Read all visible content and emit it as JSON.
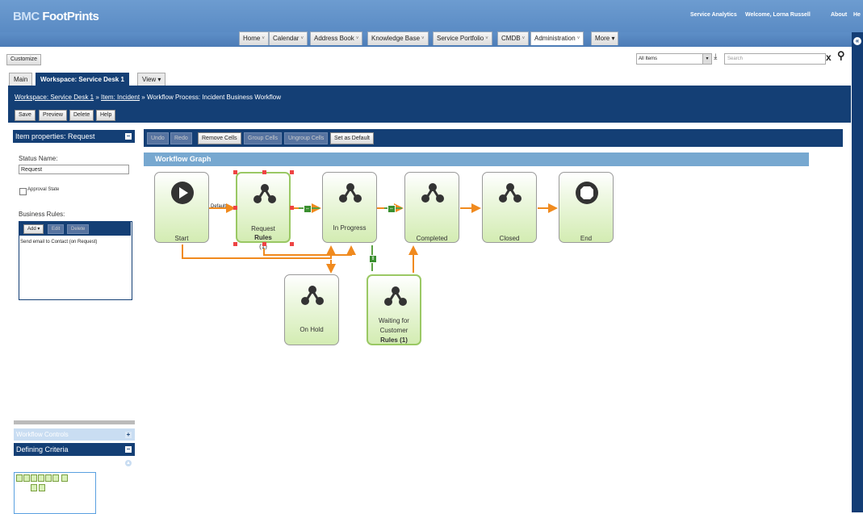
{
  "header": {
    "logo_left": "BMC",
    "logo_right": "FootPrints",
    "links": [
      "Service Analytics",
      "Welcome, Lorna Russell",
      "About",
      "He"
    ]
  },
  "nav_tabs": [
    "Home",
    "Calendar",
    "Address Book",
    "Knowledge Base",
    "Service Portfolio",
    "CMDB",
    "Administration",
    "More ▾"
  ],
  "toolbar_row": {
    "customize": "Customize",
    "filter_value": "All Items",
    "search_placeholder": "Search",
    "clear_label": "x"
  },
  "workspace_tabs": [
    "Main",
    "Workspace: Service Desk 1",
    "View ▾"
  ],
  "breadcrumb": {
    "items": [
      "Workspace: Service Desk 1",
      "Item: Incident",
      "Workflow Process: Incident Business Workflow"
    ],
    "sep": "»"
  },
  "action_buttons": [
    "Save",
    "Preview",
    "Delete",
    "Help"
  ],
  "left_panel": {
    "title": "Item properties: Request",
    "status_name_label": "Status Name:",
    "status_name_value": "Request",
    "approval_state_label": "Approval State",
    "business_rules_label": "Business Rules:",
    "rules_buttons": [
      "Add ▾",
      "Edit",
      "Delete"
    ],
    "rules": [
      "Send email to Contact (on Request)"
    ],
    "workflow_controls": "Workflow Controls",
    "defining_criteria": "Defining Criteria"
  },
  "graph_toolbar": [
    "Undo",
    "Redo",
    "Remove Cells",
    "Group Cells",
    "Ungroup Cells",
    "Set as Default"
  ],
  "graph": {
    "title": "Workflow Graph",
    "default_label": "Default",
    "nodes": [
      {
        "label": "Start",
        "sub": ""
      },
      {
        "label": "Request",
        "sub": "Rules",
        "sub2": "(1)"
      },
      {
        "label": "In Progress",
        "sub": ""
      },
      {
        "label": "Completed",
        "sub": ""
      },
      {
        "label": "Closed",
        "sub": ""
      },
      {
        "label": "End",
        "sub": ""
      },
      {
        "label": "On Hold",
        "sub": ""
      },
      {
        "label": "Waiting for",
        "label2": "Customer",
        "sub": "Rules (1)"
      }
    ]
  },
  "colors": {
    "brand_dark": "#143f75",
    "graph_header": "#77a8d0",
    "node_fill": "#d3ecb2",
    "edge_orange": "#f08a1e",
    "connector_green": "#3a8f2f"
  }
}
